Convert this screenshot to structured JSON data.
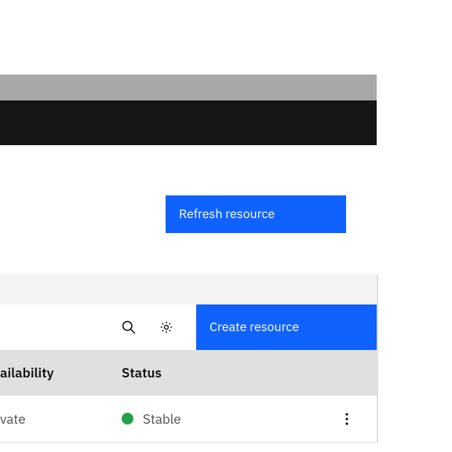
{
  "actions": {
    "refresh_label": "Refresh resource",
    "create_label": "Create resource"
  },
  "table": {
    "headers": {
      "availability": "ailability",
      "status": "Status"
    },
    "row": {
      "availability": "vate",
      "status_text": "Stable",
      "status_color": "#24a148"
    }
  },
  "icons": {
    "search": "search-icon",
    "settings": "gear-icon",
    "overflow": "overflow-menu-icon"
  }
}
